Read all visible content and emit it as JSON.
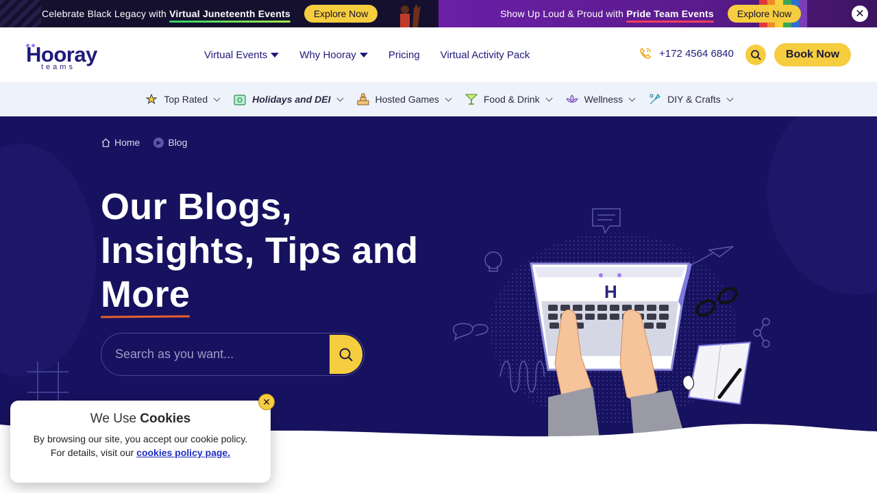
{
  "promo": {
    "left": {
      "text": "Celebrate Black Legacy with ",
      "bold": "Virtual Juneteenth Events",
      "button": "Explore Now"
    },
    "right": {
      "text": "Show Up Loud & Proud with ",
      "bold": "Pride Team Events",
      "button": "Explore Now"
    },
    "close": "✕"
  },
  "header": {
    "logo_main": "Hooray",
    "logo_sub": "teams",
    "nav": [
      {
        "label": "Virtual Events",
        "dropdown": true
      },
      {
        "label": "Why Hooray",
        "dropdown": true
      },
      {
        "label": "Pricing",
        "dropdown": false
      },
      {
        "label": "Virtual Activity Pack",
        "dropdown": false
      }
    ],
    "phone": "+172 4564 6840",
    "book": "Book Now"
  },
  "categories": [
    {
      "label": "Top Rated",
      "icon": "star-icon"
    },
    {
      "label": "Holidays and DEI",
      "icon": "calendar-icon"
    },
    {
      "label": "Hosted Games",
      "icon": "trophy-icon"
    },
    {
      "label": "Food & Drink",
      "icon": "cocktail-icon"
    },
    {
      "label": "Wellness",
      "icon": "lotus-icon"
    },
    {
      "label": "DIY & Crafts",
      "icon": "craft-icon"
    }
  ],
  "hero": {
    "breadcrumb": [
      "Home",
      "Blog"
    ],
    "title_line1": "Our Blogs,",
    "title_line2": "Insights, Tips and",
    "title_line3": "More",
    "search_placeholder": "Search as you want..."
  },
  "cookie": {
    "title_prefix": "We Use ",
    "title_bold": "Cookies",
    "line1": "By browsing our site, you accept our cookie policy.",
    "line2_prefix": "For details, visit our ",
    "link": "cookies policy page.",
    "close": "✕"
  },
  "colors": {
    "navy": "#17125f",
    "yellow": "#f5cd3f",
    "purple": "#6b1fa6",
    "brand": "#1f1a7a"
  }
}
